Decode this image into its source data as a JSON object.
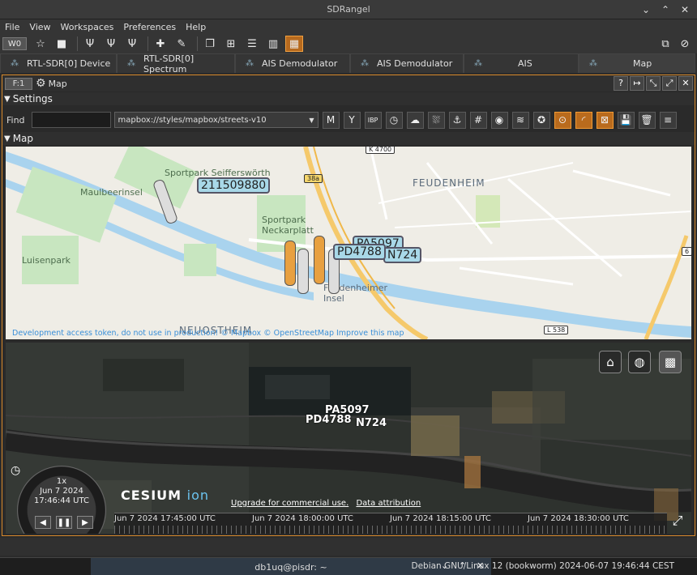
{
  "window": {
    "title": "SDRangel"
  },
  "menu": [
    "File",
    "View",
    "Workspaces",
    "Preferences",
    "Help"
  ],
  "toolbar": {
    "workspace": "W0"
  },
  "tabs": [
    {
      "label": "RTL-SDR[0] Device"
    },
    {
      "label": "RTL-SDR[0] Spectrum"
    },
    {
      "label": "AIS Demodulator"
    },
    {
      "label": "AIS Demodulator"
    },
    {
      "label": "AIS"
    },
    {
      "label": "Map"
    }
  ],
  "subwindow": {
    "index": "F:1",
    "title": "Map"
  },
  "settings": {
    "section": "Settings",
    "find_label": "Find",
    "find_value": "",
    "map_style": "mapbox://styles/mapbox/streets-v10"
  },
  "map_section": "Map",
  "map2d": {
    "labels": [
      "Sportpark Seifferswörth",
      "Maulbeerinsel",
      "FEUDENHEIM",
      "Sportpark Neckarplatt",
      "Luisenpark",
      "Feudenheimer Insel",
      "NEUOSTHEIM"
    ],
    "roads": [
      "38a",
      "L 538",
      "6",
      "K 4700"
    ],
    "ais": [
      "211509880",
      "PD4788",
      "PA5097",
      "N724"
    ],
    "attribution": "Development access token, do not use in production! © Mapbox © OpenStreetMap Improve this map"
  },
  "map3d": {
    "ais": [
      "PA5097",
      "PD4788",
      "N724"
    ],
    "speed": "1x",
    "date": "Jun 7 2024",
    "time": "17:46:44 UTC",
    "timeline": [
      "Jun 7 2024 17:45:00 UTC",
      "Jun 7 2024 18:00:00 UTC",
      "Jun 7 2024 18:15:00 UTC",
      "Jun 7 2024 18:30:00 UTC"
    ],
    "logo_main": "CESIUM",
    "logo_sub": "ion",
    "link_upgrade": "Upgrade for commercial use.",
    "link_data": "Data attribution"
  },
  "taskbar": {
    "terminal": "db1uq@pisdr: ~",
    "sysinfo": "Debian GNU/Linux 12 (bookworm)  2024-06-07 19:46:44 CEST"
  }
}
